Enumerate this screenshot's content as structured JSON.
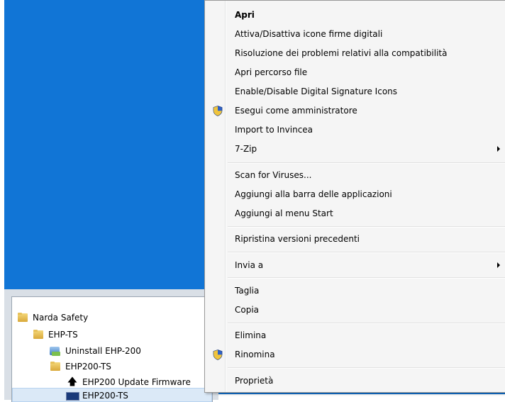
{
  "start_menu": {
    "items": [
      {
        "label": "Narda Safety",
        "icon": "folder-icon"
      },
      {
        "label": "EHP-TS",
        "icon": "folder-icon"
      },
      {
        "label": "Uninstall EHP-200",
        "icon": "uninstall-icon"
      },
      {
        "label": "EHP200-TS",
        "icon": "folder-icon"
      },
      {
        "label": "EHP200 Update Firmware",
        "icon": "arrow-up-icon"
      },
      {
        "label": "EHP200-TS",
        "icon": "application-icon"
      }
    ]
  },
  "context_menu": {
    "items": [
      {
        "label": "Apri"
      },
      {
        "label": "Attiva/Disattiva icone firme digitali"
      },
      {
        "label": "Risoluzione dei problemi relativi alla compatibilità"
      },
      {
        "label": "Apri percorso file"
      },
      {
        "label": "Enable/Disable Digital Signature Icons"
      },
      {
        "label": "Esegui come amministratore"
      },
      {
        "label": "Import to Invincea"
      },
      {
        "label": "7-Zip"
      },
      {
        "label": "Scan for Viruses..."
      },
      {
        "label": "Aggiungi alla barra delle applicazioni"
      },
      {
        "label": "Aggiungi al menu Start"
      },
      {
        "label": "Ripristina versioni precedenti"
      },
      {
        "label": "Invia a"
      },
      {
        "label": "Taglia"
      },
      {
        "label": "Copia"
      },
      {
        "label": "Elimina"
      },
      {
        "label": "Rinomina"
      },
      {
        "label": "Proprietà"
      }
    ]
  },
  "colors": {
    "desktop": "#1175d6",
    "menu_background": "#f5f5f5",
    "selection": "#dbe9f7"
  }
}
